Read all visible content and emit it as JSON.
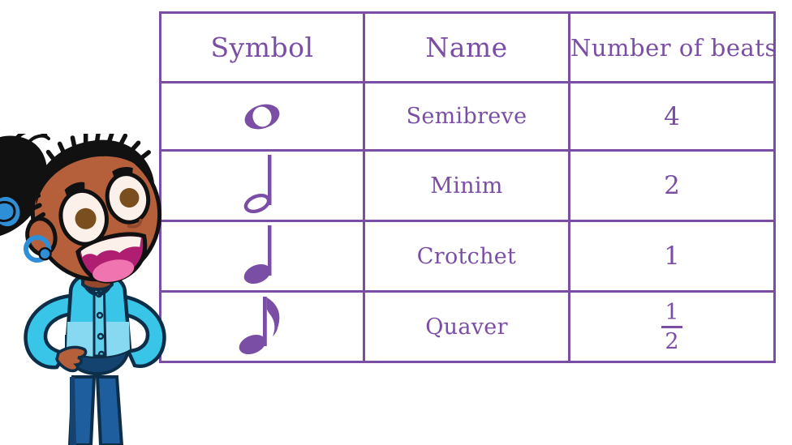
{
  "page": {
    "background_color": "#ffffff",
    "accent_color": "#7B4EA5"
  },
  "table": {
    "name": "note-values-table",
    "border_color": "#7B4EA5",
    "headers": [
      {
        "key": "symbol",
        "label": "Symbol"
      },
      {
        "key": "name",
        "label": "Name"
      },
      {
        "key": "beats",
        "label": "Number of beats"
      }
    ],
    "rows": [
      {
        "symbol_icon": "semibreve-note-icon",
        "name": "Semibreve",
        "beats": "4",
        "beats_is_fraction": false
      },
      {
        "symbol_icon": "minim-note-icon",
        "name": "Minim",
        "beats": "2",
        "beats_is_fraction": false
      },
      {
        "symbol_icon": "crotchet-note-icon",
        "name": "Crotchet",
        "beats": "1",
        "beats_is_fraction": false
      },
      {
        "symbol_icon": "quaver-note-icon",
        "name": "Quaver",
        "beats": "1/2",
        "beats_is_fraction": true,
        "beats_numerator": "1",
        "beats_denominator": "2"
      }
    ]
  },
  "character": {
    "name": "cartoon-presenter-illustration",
    "description": "Smiling cartoon child with braided hair, blue shirt and navy trousers",
    "colors": {
      "skin": "#B5603B",
      "skin_shadow": "#95482C",
      "hair": "#111111",
      "shirt": "#39C5E8",
      "shirt_light": "#86D9F0",
      "shirt_outline": "#0D2E49",
      "trousers": "#1E5E9E",
      "trousers_dark": "#14436F",
      "accessory_blue": "#2E8FD6",
      "mouth": "#B01E72",
      "tongue": "#EF74B0",
      "eye_white": "#FBF0EA",
      "iris": "#7A4E1E"
    }
  }
}
